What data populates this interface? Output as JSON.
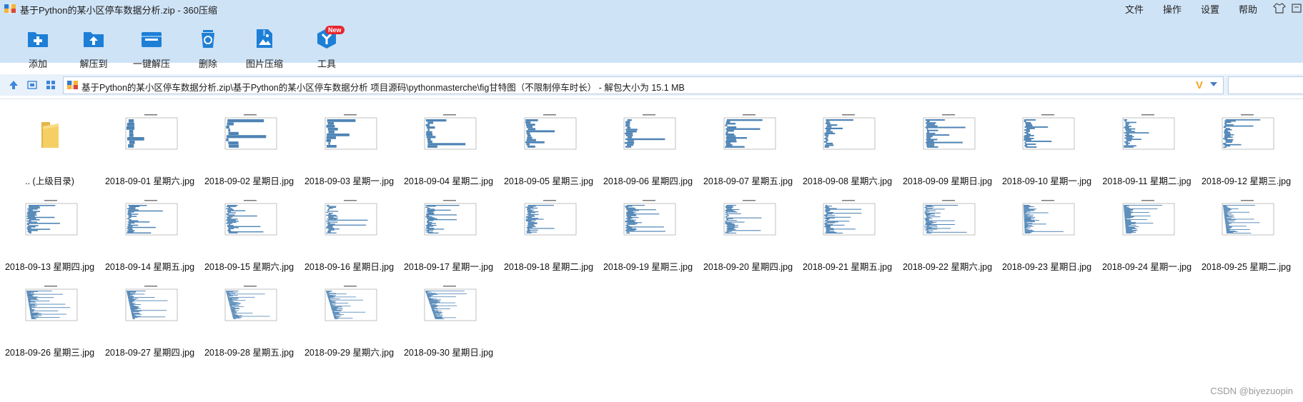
{
  "window": {
    "title": "基于Python的某小区停车数据分析.zip - 360压缩"
  },
  "menu": {
    "items": [
      "文件",
      "操作",
      "设置",
      "帮助"
    ]
  },
  "toolbar": {
    "items": [
      {
        "label": "添加",
        "icon": "add-icon"
      },
      {
        "label": "解压到",
        "icon": "extract-to-icon"
      },
      {
        "label": "一键解压",
        "icon": "one-click-extract-icon"
      },
      {
        "label": "删除",
        "icon": "delete-icon"
      },
      {
        "label": "图片压缩",
        "icon": "image-compress-icon"
      },
      {
        "label": "工具",
        "icon": "tools-icon"
      }
    ],
    "new_badge": "New"
  },
  "address": {
    "path": "基于Python的某小区停车数据分析.zip\\基于Python的某小区停车数据分析 项目源码\\pythonmasterche\\fig甘特图（不限制停车时长） - 解包大小为 15.1 MB"
  },
  "files": {
    "parent": ".. (上级目录)",
    "items": [
      "2018-09-01 星期六.jpg",
      "2018-09-02 星期日.jpg",
      "2018-09-03 星期一.jpg",
      "2018-09-04 星期二.jpg",
      "2018-09-05 星期三.jpg",
      "2018-09-06 星期四.jpg",
      "2018-09-07 星期五.jpg",
      "2018-09-08 星期六.jpg",
      "2018-09-09 星期日.jpg",
      "2018-09-10 星期一.jpg",
      "2018-09-11 星期二.jpg",
      "2018-09-12 星期三.jpg",
      "2018-09-13 星期四.jpg",
      "2018-09-14 星期五.jpg",
      "2018-09-15 星期六.jpg",
      "2018-09-16 星期日.jpg",
      "2018-09-17 星期一.jpg",
      "2018-09-18 星期二.jpg",
      "2018-09-19 星期三.jpg",
      "2018-09-20 星期四.jpg",
      "2018-09-21 星期五.jpg",
      "2018-09-22 星期六.jpg",
      "2018-09-23 星期日.jpg",
      "2018-09-24 星期一.jpg",
      "2018-09-25 星期二.jpg",
      "2018-09-26 星期三.jpg",
      "2018-09-27 星期四.jpg",
      "2018-09-28 星期五.jpg",
      "2018-09-29 星期六.jpg",
      "2018-09-30 星期日.jpg"
    ]
  },
  "watermark": "CSDN @biyezuopin",
  "colors": {
    "toolbar_bg": "#cfe3f7",
    "accent_blue": "#1e7fd6",
    "chart_bar": "#2f6fa8"
  }
}
